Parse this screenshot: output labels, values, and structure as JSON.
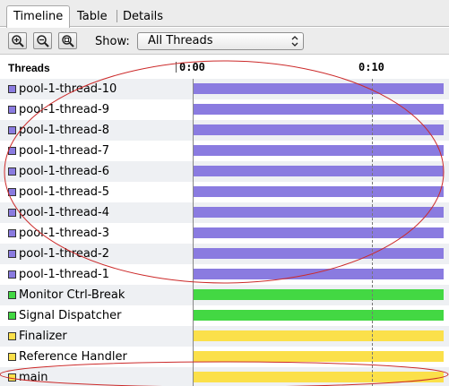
{
  "tabs": [
    {
      "label": "Timeline",
      "active": true
    },
    {
      "label": "Table",
      "active": false
    },
    {
      "label": "Details",
      "active": false
    }
  ],
  "toolbar": {
    "zoom_in_icon": "zoom-in-icon",
    "zoom_out_icon": "zoom-out-icon",
    "zoom_fit_icon": "zoom-fit-icon",
    "show_label": "Show:",
    "show_selected": "All Threads"
  },
  "header": {
    "threads_label": "Threads",
    "ticks": [
      "0:00",
      "0:10"
    ]
  },
  "colors": {
    "purple": "#8a7be0",
    "green": "#43d843",
    "yellow": "#fbe04a",
    "annotation": "#cc2a2a"
  },
  "threads": [
    {
      "name": "pool-1-thread-10",
      "color": "#8a7be0",
      "active": 1.0
    },
    {
      "name": "pool-1-thread-9",
      "color": "#8a7be0",
      "active": 1.0
    },
    {
      "name": "pool-1-thread-8",
      "color": "#8a7be0",
      "active": 1.0
    },
    {
      "name": "pool-1-thread-7",
      "color": "#8a7be0",
      "active": 1.0
    },
    {
      "name": "pool-1-thread-6",
      "color": "#8a7be0",
      "active": 1.0
    },
    {
      "name": "pool-1-thread-5",
      "color": "#8a7be0",
      "active": 1.0
    },
    {
      "name": "pool-1-thread-4",
      "color": "#8a7be0",
      "active": 1.0
    },
    {
      "name": "pool-1-thread-3",
      "color": "#8a7be0",
      "active": 1.0
    },
    {
      "name": "pool-1-thread-2",
      "color": "#8a7be0",
      "active": 1.0
    },
    {
      "name": "pool-1-thread-1",
      "color": "#8a7be0",
      "active": 1.0
    },
    {
      "name": "Monitor Ctrl-Break",
      "color": "#43d843",
      "active": 1.0
    },
    {
      "name": "Signal Dispatcher",
      "color": "#43d843",
      "active": 1.0
    },
    {
      "name": "Finalizer",
      "color": "#fbe04a",
      "active": 1.0
    },
    {
      "name": "Reference Handler",
      "color": "#fbe04a",
      "active": 1.0
    },
    {
      "name": "main",
      "color": "#fbe04a",
      "active": 1.0
    }
  ]
}
